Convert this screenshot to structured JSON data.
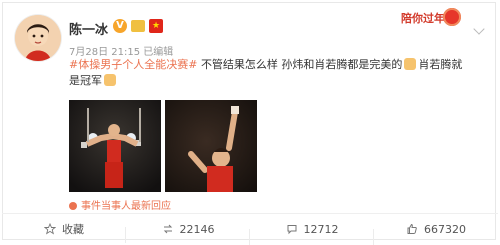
{
  "header": {
    "username": "陈一冰",
    "date": "7月28日 21:15",
    "edited": "已编辑",
    "newyear_badge": "陪你过年"
  },
  "post": {
    "hashtag": "#体操男子个人全能决赛#",
    "text_1": "不管结果怎么样 孙炜和肖若腾都是完美的",
    "text_2": "肖若腾就是冠军",
    "event_link": "事件当事人最新回应"
  },
  "actions": {
    "favorite_label": "收藏",
    "repost_count": "22146",
    "comment_count": "12712",
    "like_count": "667320"
  },
  "icons": {
    "collect": "star-icon",
    "repost": "repost-icon",
    "comment": "comment-icon",
    "like": "thumb-up-icon",
    "more": "chevron-down-icon"
  },
  "colors": {
    "accent": "#eb7350",
    "newyear": "#d23a2b",
    "verified": "#f7a52b"
  }
}
